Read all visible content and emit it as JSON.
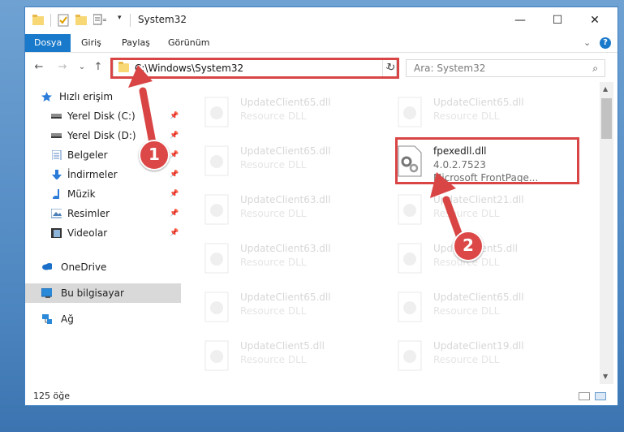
{
  "window": {
    "title": "System32"
  },
  "controls": {
    "minimize": "—",
    "maximize": "☐",
    "close": "✕",
    "collapse_ribbon": "⌄",
    "help": "?"
  },
  "ribbon": {
    "tabs": [
      "Dosya",
      "Giriş",
      "Paylaş",
      "Görünüm"
    ]
  },
  "nav": {
    "back": "←",
    "forward": "→",
    "recent": "⌄",
    "up": "↑"
  },
  "address": {
    "path": "C:\\Windows\\System32",
    "dropdown": "⌄",
    "refresh": "↻"
  },
  "search": {
    "placeholder": "Ara: System32",
    "icon": "⌕"
  },
  "sidebar": {
    "quick_access": "Hızlı erişim",
    "items": [
      {
        "label": "Yerel Disk (C:)",
        "icon": "drive-icon",
        "pinned": true
      },
      {
        "label": "Yerel Disk (D:)",
        "icon": "drive-icon",
        "pinned": true
      },
      {
        "label": "Belgeler",
        "icon": "documents-icon",
        "pinned": true
      },
      {
        "label": "İndirmeler",
        "icon": "downloads-icon",
        "pinned": true
      },
      {
        "label": "Müzik",
        "icon": "music-icon",
        "pinned": true
      },
      {
        "label": "Resimler",
        "icon": "pictures-icon",
        "pinned": true
      },
      {
        "label": "Videolar",
        "icon": "videos-icon",
        "pinned": true
      }
    ],
    "onedrive": "OneDrive",
    "this_pc": "Bu bilgisayar",
    "network": "Ağ",
    "pin_glyph": "📌"
  },
  "files": {
    "highlighted": {
      "name": "fpexedll.dll",
      "version": "4.0.2.7523",
      "description": "Microsoft FrontPage..."
    },
    "faded": [
      {
        "name": "UpdateClient65.dll",
        "type": "Resource DLL"
      },
      {
        "name": "UpdateClient65.dll",
        "type": "Resource DLL"
      },
      {
        "name": "UpdateClient65.dll",
        "type": "Resource DLL"
      },
      {
        "name": "UpdateClient63.dll",
        "type": "Resource DLL"
      },
      {
        "name": "UpdateClient21.dll",
        "type": "Resource DLL"
      },
      {
        "name": "UpdateClient63.dll",
        "type": "Resource DLL"
      },
      {
        "name": "UpdateClient5.dll",
        "type": "Resource DLL"
      },
      {
        "name": "UpdateClient65.dll",
        "type": "Resource DLL"
      },
      {
        "name": "UpdateClient65.dll",
        "type": "Resource DLL"
      },
      {
        "name": "UpdateClient5.dll",
        "type": "Resource DLL"
      },
      {
        "name": "UpdateClient19.dll",
        "type": "Resource DLL"
      }
    ]
  },
  "status": {
    "count": "125 öğe"
  },
  "annotations": {
    "step1": "1",
    "step2": "2",
    "color": "#d94545"
  }
}
